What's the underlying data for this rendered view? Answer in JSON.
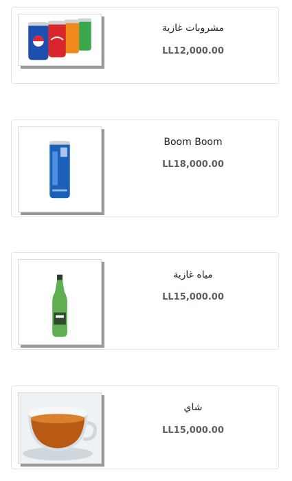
{
  "products": [
    {
      "name": "مشروبات غازية",
      "price": "LL12,000.00",
      "image_icon": "soda-cans-image"
    },
    {
      "name": "Boom Boom",
      "price": "LL18,000.00",
      "image_icon": "energy-drink-can-image"
    },
    {
      "name": "مياه غازية",
      "price": "LL15,000.00",
      "image_icon": "sparkling-water-bottle-image"
    },
    {
      "name": "شاي",
      "price": "LL15,000.00",
      "image_icon": "tea-cup-image"
    }
  ],
  "colors": {
    "price": "#5a5f66",
    "card_border": "#e3e3e3",
    "thumb_shadow": "#9a9a9a"
  }
}
